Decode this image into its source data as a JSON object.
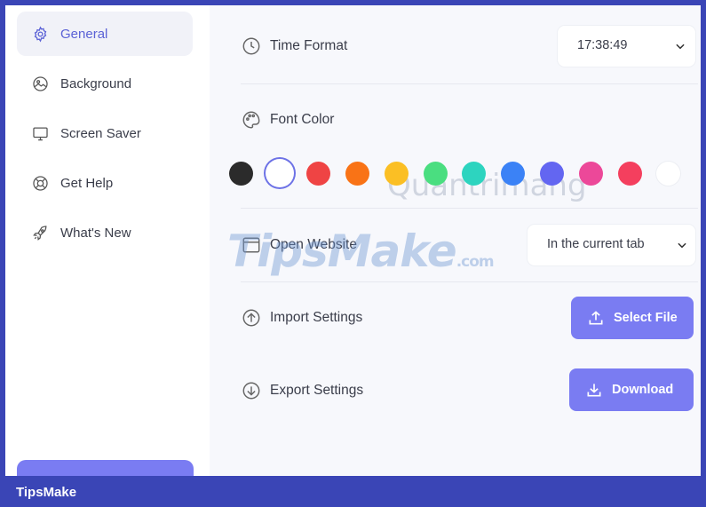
{
  "sidebar": {
    "items": [
      {
        "label": "General",
        "icon": "gear-icon",
        "active": true
      },
      {
        "label": "Background",
        "icon": "image-icon",
        "active": false
      },
      {
        "label": "Screen Saver",
        "icon": "monitor-icon",
        "active": false
      },
      {
        "label": "Get Help",
        "icon": "lifebuoy-icon",
        "active": false
      },
      {
        "label": "What's New",
        "icon": "rocket-icon",
        "active": false
      }
    ]
  },
  "settings": {
    "time_format": {
      "label": "Time Format",
      "value": "17:38:49",
      "icon": "clock-icon"
    },
    "font_color": {
      "label": "Font Color",
      "icon": "palette-icon",
      "selected": "#ffffff",
      "swatches": [
        "#2b2b2b",
        "#ffffff",
        "#ef4444",
        "#f97316",
        "#fbbf24",
        "#4ade80",
        "#2dd4bf",
        "#3b82f6",
        "#6366f1",
        "#ec4899",
        "#f43f5e",
        "#ffffff"
      ]
    },
    "open_website": {
      "label": "Open Website",
      "value": "In the current tab",
      "icon": "browser-window-icon"
    },
    "import_settings": {
      "label": "Import Settings",
      "button": "Select File",
      "icon": "arrow-up-circle-icon"
    },
    "export_settings": {
      "label": "Export Settings",
      "button": "Download",
      "icon": "arrow-down-circle-icon"
    }
  },
  "watermarks": {
    "tipsmake": "TipsMake",
    "tipsmake_suffix": ".com",
    "quantrimang": "Quantrimang"
  },
  "footer": {
    "brand": "TipsMake"
  },
  "colors": {
    "accent": "#7a7cf2",
    "active_text": "#5b62d6",
    "frame": "#3a45b6"
  }
}
